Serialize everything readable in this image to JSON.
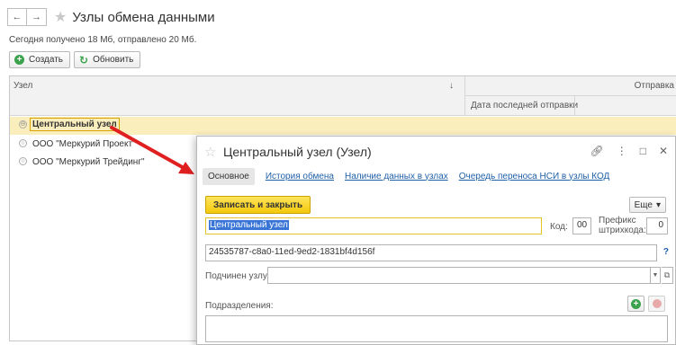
{
  "window": {
    "back_glyph": "←",
    "forward_glyph": "→",
    "title": "Узлы обмена данными"
  },
  "status": "Сегодня получено 18 Мб, отправлено 20 Мб.",
  "toolbar": {
    "create_label": "Создать",
    "refresh_label": "Обновить"
  },
  "table": {
    "col_node": "Узел",
    "sort_glyph": "↓",
    "col_send_group": "Отправка",
    "col_last_send": "Дата последней отправки",
    "rows": [
      {
        "collapse": "⊖",
        "text": "Центральный узел"
      },
      {
        "collapse": "○",
        "text": "ООО \"Меркурий Проект\""
      },
      {
        "collapse": "○",
        "text": "ООО \"Меркурий Трейдинг\""
      }
    ]
  },
  "dialog": {
    "title": "Центральный узел (Узел)",
    "tabs": [
      "Основное",
      "История обмена",
      "Наличие данных в узлах",
      "Очередь переноса НСИ в узлы КОД"
    ],
    "save_close_label": "Записать и закрыть",
    "more_label": "Еще",
    "name_value": "Центральный узел",
    "code_label": "Код:",
    "code_value": "00",
    "prefix_label_1": "Префикс",
    "prefix_label_2": "штрихкода:",
    "prefix_value": "0",
    "uuid_value": "24535787-c8a0-11ed-9ed2-1831bf4d156f",
    "help_glyph": "?",
    "parent_label": "Подчинен узлу:",
    "parent_value": "",
    "divisions_label": "Подразделения:"
  },
  "icons": {
    "star": "star-icon",
    "link": "link-icon",
    "menu": "more-vert-icon",
    "maximize": "maximize-icon",
    "close": "close-icon",
    "add": "plus-circle-icon",
    "delete": "delete-circle-icon"
  },
  "colors": {
    "accent_yellow": "#f3c90b",
    "selection": "#fbeebd",
    "link": "#1f5fa8",
    "green": "#3aa24b",
    "arrow": "#e02020"
  }
}
